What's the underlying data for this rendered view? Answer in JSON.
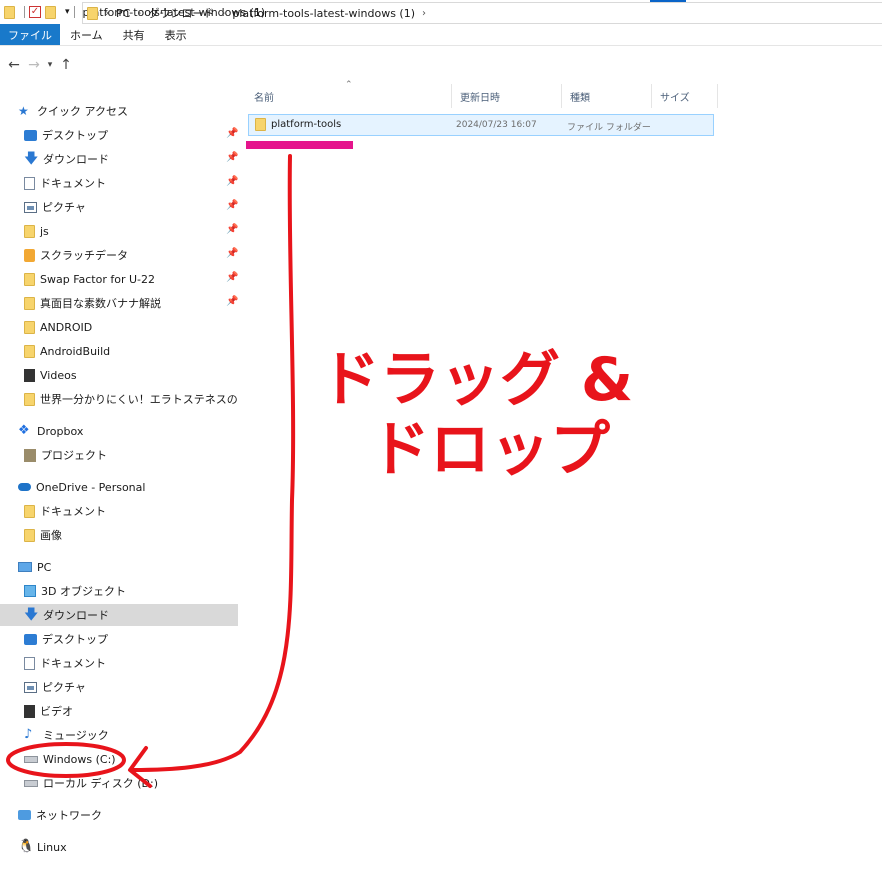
{
  "window": {
    "title": "platform-tools-latest-windows (1)"
  },
  "ribbon": {
    "tabs": [
      "ファイル",
      "ホーム",
      "共有",
      "表示"
    ]
  },
  "address": {
    "crumbs": [
      "PC",
      "ダウンロード",
      "platform-tools-latest-windows (1)"
    ]
  },
  "columns": {
    "name": "名前",
    "date": "更新日時",
    "type": "種類",
    "size": "サイズ"
  },
  "files": [
    {
      "name": "platform-tools",
      "date": "2024/07/23 16:07",
      "type": "ファイル フォルダー"
    }
  ],
  "sidebar": {
    "items": [
      {
        "label": "クイック アクセス",
        "icon": "star-icon"
      },
      {
        "label": "デスクトップ",
        "icon": "desktop-icon",
        "pinned": true
      },
      {
        "label": "ダウンロード",
        "icon": "download-icon",
        "pinned": true
      },
      {
        "label": "ドキュメント",
        "icon": "document-icon",
        "pinned": true
      },
      {
        "label": "ピクチャ",
        "icon": "pictures-icon",
        "pinned": true
      },
      {
        "label": "js",
        "icon": "folder-icon",
        "pinned": true
      },
      {
        "label": "スクラッチデータ",
        "icon": "scratch-folder-icon",
        "pinned": true
      },
      {
        "label": "Swap Factor for U-22",
        "icon": "folder-icon",
        "pinned": true
      },
      {
        "label": "真面目な素数バナナ解説",
        "icon": "folder-icon",
        "pinned": true
      },
      {
        "label": "ANDROID",
        "icon": "folder-icon"
      },
      {
        "label": "AndroidBuild",
        "icon": "folder-icon"
      },
      {
        "label": "Videos",
        "icon": "videos-icon"
      },
      {
        "label": "世界一分かりにくい！エラトステネスの篩ってなーんだ！",
        "icon": "folder-icon"
      },
      {
        "label": "Dropbox",
        "icon": "dropbox-icon"
      },
      {
        "label": "プロジェクト",
        "icon": "project-folder-icon"
      },
      {
        "label": "OneDrive - Personal",
        "icon": "onedrive-icon"
      },
      {
        "label": "ドキュメント",
        "icon": "folder-icon"
      },
      {
        "label": "画像",
        "icon": "folder-icon"
      },
      {
        "label": "PC",
        "icon": "pc-icon"
      },
      {
        "label": "3D オブジェクト",
        "icon": "3d-objects-icon"
      },
      {
        "label": "ダウンロード",
        "icon": "download-icon",
        "selected": true
      },
      {
        "label": "デスクトップ",
        "icon": "desktop-icon"
      },
      {
        "label": "ドキュメント",
        "icon": "document-icon"
      },
      {
        "label": "ピクチャ",
        "icon": "pictures-icon"
      },
      {
        "label": "ビデオ",
        "icon": "videos-icon"
      },
      {
        "label": "ミュージック",
        "icon": "music-icon"
      },
      {
        "label": "Windows (C:)",
        "icon": "drive-icon"
      },
      {
        "label": "ローカル ディスク (D:)",
        "icon": "drive-icon"
      },
      {
        "label": "ネットワーク",
        "icon": "network-icon"
      },
      {
        "label": "Linux",
        "icon": "linux-icon"
      }
    ]
  },
  "annotation": {
    "line1": "ドラッグ &",
    "line2": "ドロップ",
    "color": "#e8141b",
    "highlight_color": "#e5148c"
  }
}
